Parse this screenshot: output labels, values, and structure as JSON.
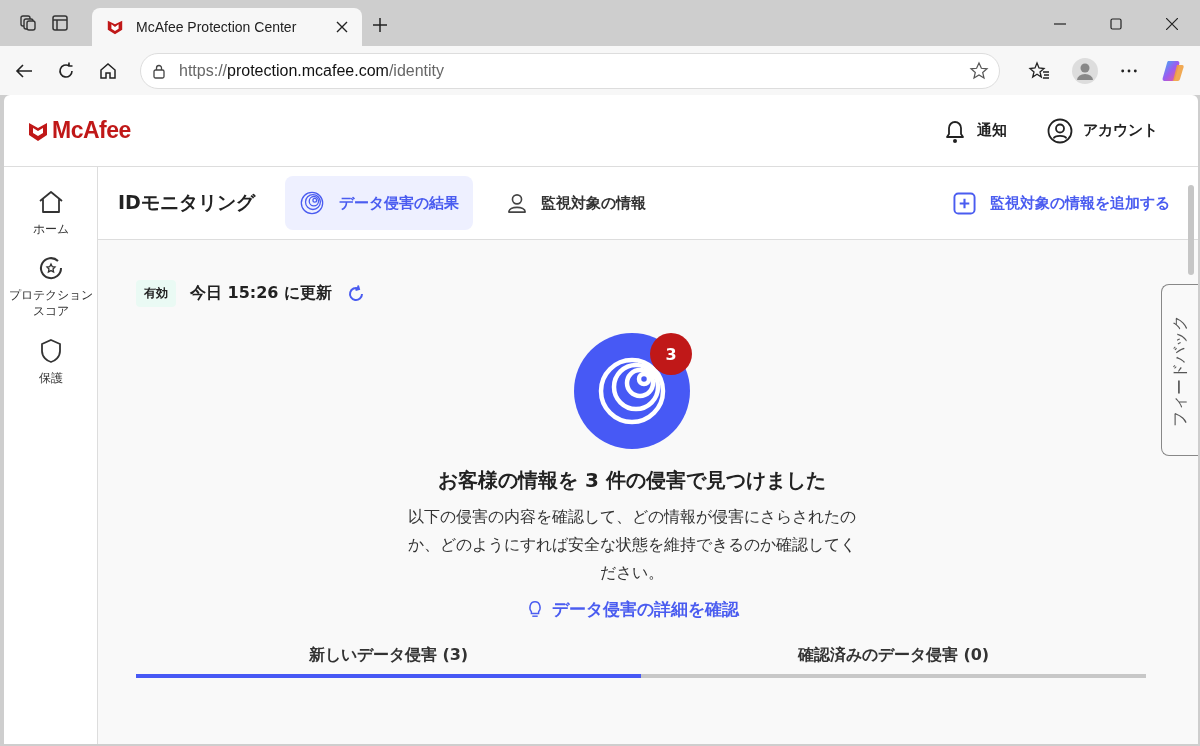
{
  "browser": {
    "tabs": [
      {
        "title": "McAfee Protection Center",
        "selected": true
      }
    ],
    "url_host": "protection.mcafee.com",
    "url_scheme": "https://",
    "url_path": "/identity"
  },
  "header": {
    "logo": "McAfee",
    "actions": [
      {
        "kind": "bell",
        "label": "通知"
      },
      {
        "kind": "account",
        "label": "アカウント"
      }
    ]
  },
  "sidebar": {
    "items": [
      {
        "kind": "home",
        "label": "ホーム"
      },
      {
        "kind": "score",
        "label": "プロテクションスコア"
      },
      {
        "kind": "shield",
        "label": "保護"
      }
    ]
  },
  "page": {
    "title": "IDモニタリング",
    "tabs": [
      {
        "kind": "fingerprint",
        "label": "データ侵害の結果",
        "selected": true
      },
      {
        "kind": "person",
        "label": "監視対象の情報",
        "selected": false
      }
    ],
    "add_link": "監視対象の情報を追加する"
  },
  "status": {
    "badge": "有効",
    "updated": "今日 15:26 に更新"
  },
  "summary": {
    "count_badge": "3",
    "heading": "お客様の情報を 3 件の侵害で見つけました",
    "body": "以下の侵害の内容を確認して、どの情報が侵害にさらされたのか、どのようにすれば安全な状態を維持できるのか確認してください。",
    "details_link": "データ侵害の詳細を確認"
  },
  "breach_tabs": [
    {
      "label": "新しいデータ侵害 (3)",
      "selected": true
    },
    {
      "label": "確認済みのデータ侵害 (0)",
      "selected": false
    }
  ],
  "feedback": "フィードバック"
}
